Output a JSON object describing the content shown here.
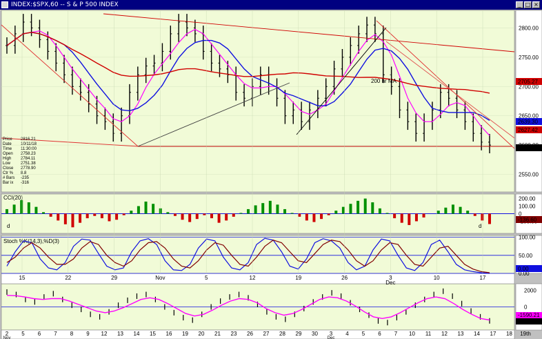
{
  "window": {
    "title": "INDEX:$SPX,60 -- S & P 500 INDEX",
    "icon": "chart-window-icon"
  },
  "colors": {
    "chart_bg": "#f1fbd7",
    "axis_bg": "#ffffff",
    "blue": "#1010e0",
    "red": "#d00000",
    "magenta": "#ff00ff",
    "green": "#009000",
    "maroon": "#800000",
    "navy": "#000080"
  },
  "info_box": [
    {
      "label": "Price",
      "value": "2816.21"
    },
    {
      "label": "Date",
      "value": "10/11/18"
    },
    {
      "label": "Time",
      "value": "11:30:00"
    },
    {
      "label": "Open",
      "value": "2758.23"
    },
    {
      "label": "High",
      "value": "2784.11"
    },
    {
      "label": "Low",
      "value": "2751.38"
    },
    {
      "label": "Close",
      "value": "2778.90"
    },
    {
      "label": "Ctr %",
      "value": "8.8"
    },
    {
      "label": "# Bars",
      "value": "-235"
    },
    {
      "label": "Bar ix",
      "value": "-316"
    }
  ],
  "annotations": {
    "ma_label": "200 hr MA",
    "cci_d": "d"
  },
  "chart_data": [
    {
      "type": "line",
      "title": "INDEX:$SPX,60 -- S & P 500 INDEX",
      "y_ticks": [
        "2800.00",
        "2750.00",
        "2700.00",
        "2650.00",
        "2600.00",
        "2550.00"
      ],
      "ylim": [
        2520,
        2830
      ],
      "value_tags": [
        {
          "value": "2705.27",
          "color": "#d00000"
        },
        {
          "value": "2639.30",
          "color": "#1010e0"
        },
        {
          "value": "2627.42",
          "color": "#d00000"
        },
        {
          "value": "2600.04",
          "color": "#000000"
        }
      ],
      "series": [
        {
          "name": "",
          "values": [
            2770,
            2790,
            2810,
            2800,
            2780,
            2760,
            2740,
            2720,
            2700,
            2690,
            2670,
            2650,
            2640,
            2620,
            2650,
            2690,
            2720,
            2735,
            2740,
            2760,
            2790,
            2810,
            2800,
            2790,
            2760,
            2740,
            2730,
            2720,
            2690,
            2680,
            2700,
            2720,
            2700,
            2680,
            2650,
            2660,
            2640,
            2660,
            2680,
            2700,
            2730,
            2750,
            2770,
            2790,
            2805,
            2790,
            2720,
            2700,
            2660,
            2640,
            2620,
            2640,
            2660,
            2690,
            2680,
            2660,
            2640,
            2620,
            2605,
            2600
          ]
        }
      ]
    },
    {
      "type": "bar",
      "title": "CCI(20)",
      "y_ticks": [
        "200.00",
        "100.00",
        "0",
        "-100.00"
      ],
      "ylim": [
        -260,
        260
      ],
      "value_tags": [
        {
          "value": "-136.60",
          "color": "#800000"
        }
      ],
      "values": [
        60,
        120,
        180,
        150,
        90,
        20,
        -40,
        -90,
        -140,
        -180,
        -120,
        -60,
        -30,
        -60,
        -100,
        -80,
        -20,
        40,
        100,
        160,
        130,
        70,
        20,
        -30,
        -80,
        -110,
        -70,
        -20,
        -60,
        -120,
        -90,
        -40,
        10,
        60,
        110,
        140,
        170,
        120,
        60,
        10,
        -40,
        -90,
        -110,
        -70,
        -20,
        40,
        90,
        130,
        170,
        200,
        150,
        70,
        10,
        -60,
        -120,
        -150,
        -100,
        -50,
        0,
        40,
        80,
        120,
        90,
        40,
        -30,
        -90,
        -136.6
      ]
    },
    {
      "type": "line",
      "title": "Stoch %K(14,3),%D(3)",
      "y_ticks": [
        "100.00",
        "50.00",
        "0.00"
      ],
      "ylim": [
        0,
        105
      ],
      "value_tags": [
        {
          "value": "0.00",
          "color": "#1010e0"
        }
      ],
      "series": [
        {
          "name": "%K",
          "values": [
            20,
            60,
            90,
            85,
            40,
            15,
            10,
            30,
            75,
            95,
            92,
            55,
            20,
            10,
            15,
            60,
            90,
            96,
            80,
            35,
            10,
            8,
            25,
            70,
            95,
            90,
            45,
            15,
            10,
            30,
            80,
            97,
            92,
            60,
            20,
            12,
            40,
            85,
            96,
            90,
            70,
            30,
            10,
            20,
            65,
            95,
            90,
            50,
            15,
            8,
            30,
            80,
            92,
            60,
            25,
            10,
            5,
            2,
            0
          ]
        },
        {
          "name": "%D",
          "values": [
            30,
            45,
            70,
            85,
            70,
            45,
            25,
            25,
            40,
            70,
            88,
            80,
            50,
            30,
            20,
            35,
            65,
            85,
            88,
            70,
            40,
            20,
            15,
            35,
            65,
            85,
            78,
            50,
            25,
            20,
            45,
            75,
            92,
            85,
            60,
            35,
            30,
            55,
            80,
            92,
            88,
            65,
            35,
            20,
            35,
            65,
            85,
            80,
            50,
            25,
            20,
            45,
            70,
            75,
            50,
            25,
            12,
            5,
            2
          ]
        }
      ]
    },
    {
      "type": "line",
      "title": "",
      "y_ticks": [
        "2000",
        "0"
      ],
      "ylim": [
        -2800,
        2800
      ],
      "value_tags": [
        {
          "value": "-1590.21",
          "color": "#ff00ff"
        },
        {
          "value": "-1691",
          "color": "#000000"
        }
      ],
      "series": [
        {
          "name": "",
          "values": [
            1800,
            1500,
            900,
            600,
            1200,
            1600,
            900,
            200,
            -300,
            -900,
            -1200,
            -600,
            200,
            800,
            1300,
            1500,
            900,
            0,
            -700,
            -1300,
            -1600,
            -900,
            0,
            700,
            1200,
            1500,
            1100,
            300,
            -600,
            -1200,
            -1500,
            -900,
            -200,
            600,
            1200,
            1700,
            1300,
            500,
            -300,
            -1000,
            -1700,
            -1900,
            -1300,
            -600,
            200,
            900,
            1500,
            1900,
            1300,
            400,
            -500,
            -1200,
            -1691
          ]
        },
        {
          "name": "",
          "values": [
            1400,
            1350,
            1200,
            1000,
            900,
            1000,
            1000,
            700,
            300,
            -100,
            -500,
            -700,
            -500,
            -100,
            400,
            900,
            1100,
            900,
            400,
            -200,
            -800,
            -1100,
            -900,
            -400,
            200,
            700,
            1000,
            900,
            500,
            -200,
            -700,
            -1000,
            -800,
            -300,
            300,
            900,
            1200,
            1100,
            700,
            100,
            -600,
            -1200,
            -1400,
            -1200,
            -700,
            -100,
            500,
            1000,
            1200,
            1000,
            400,
            -300,
            -900,
            -1400,
            -1590
          ]
        }
      ]
    }
  ],
  "x_axis_top": {
    "labels": [
      "15",
      "22",
      "29",
      "Nov",
      "5",
      "12",
      "19",
      "26",
      "3",
      "10",
      "17"
    ],
    "sub_labels": [
      "",
      "",
      "",
      "",
      "",
      "",
      "",
      "",
      "Dec",
      "",
      ""
    ]
  },
  "x_axis_bottom": {
    "labels": [
      "2",
      "5",
      "6",
      "7",
      "8",
      "9",
      "12",
      "13",
      "14",
      "15",
      "16",
      "19",
      "20",
      "21",
      "23",
      "26",
      "27",
      "28",
      "29",
      "30",
      "3",
      "4",
      "5",
      "6",
      "7",
      "10",
      "11",
      "12",
      "13",
      "14",
      "17",
      "18",
      "19th"
    ],
    "sub_labels": [
      "Nov",
      "Dec"
    ]
  }
}
